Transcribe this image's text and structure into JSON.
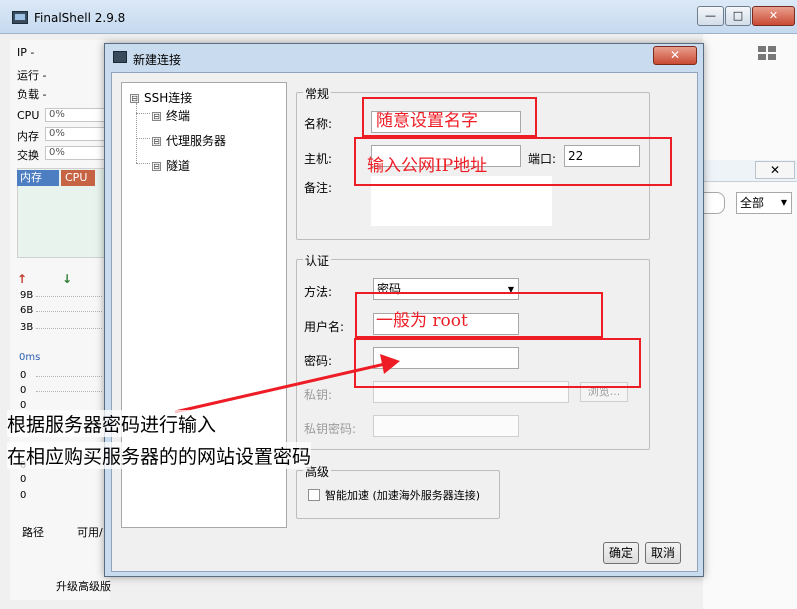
{
  "main_window": {
    "title": "FinalShell 2.9.8",
    "min_button": "—",
    "max_button": "□",
    "close_button": "✕",
    "info": {
      "ip_label": "IP  -",
      "run_label": "运行 -",
      "load_label": "负载 -"
    },
    "stats": {
      "cpu_label": "CPU",
      "cpu_value": "0%",
      "mem_label": "内存",
      "mem_value": "0%",
      "swap_label": "交换",
      "swap_value": "0%"
    },
    "tabs": {
      "mem": "内存",
      "cpu": "CPU"
    },
    "net": {
      "up_arrow": "↑",
      "down_arrow": "↓",
      "v1": "9B",
      "v2": "6B",
      "v3": "3B"
    },
    "latency": {
      "label": "0ms",
      "r1": "0",
      "r2": "0",
      "r3": "0",
      "r4": "0",
      "r5": "0",
      "r6": "0"
    },
    "disk": {
      "path_header": "路径",
      "avail_header": "可用/"
    },
    "upgrade_text": "升级高级版",
    "right_panel": {
      "close_icon": "✕",
      "filter_value": "全部",
      "dropdown_icon": "▼"
    }
  },
  "dialog": {
    "title": "新建连接",
    "close_button": "✕",
    "tree": {
      "root": "SSH连接",
      "children": [
        "终端",
        "代理服务器",
        "隧道"
      ],
      "toggle_symbol": "⊟"
    },
    "general": {
      "legend": "常规",
      "name_label": "名称:",
      "name_value": "",
      "host_label": "主机:",
      "host_value": "",
      "port_label": "端口:",
      "port_value": "22",
      "note_label": "备注:",
      "note_value": ""
    },
    "auth": {
      "legend": "认证",
      "method_label": "方法:",
      "method_value": "密码",
      "dropdown_icon": "▼",
      "user_label": "用户名:",
      "user_value": "",
      "password_label": "密码:",
      "password_value": "",
      "key_label": "私钥:",
      "browse_label": "浏览...",
      "key_password_label": "私钥密码:"
    },
    "advanced": {
      "legend": "高级",
      "accelerate_label": "智能加速 (加速海外服务器连接)",
      "accelerate_checked": false
    },
    "ok_button": "确定",
    "cancel_button": "取消"
  },
  "annotations": {
    "name_hint": "随意设置名字",
    "host_hint": "输入公网IP地址",
    "user_hint": "一般为 root",
    "password_note_line1": "根据服务器密码进行输入",
    "password_note_line2": "在相应购买服务器的的网站设置密码",
    "highlight_color": "#ee1c24"
  }
}
